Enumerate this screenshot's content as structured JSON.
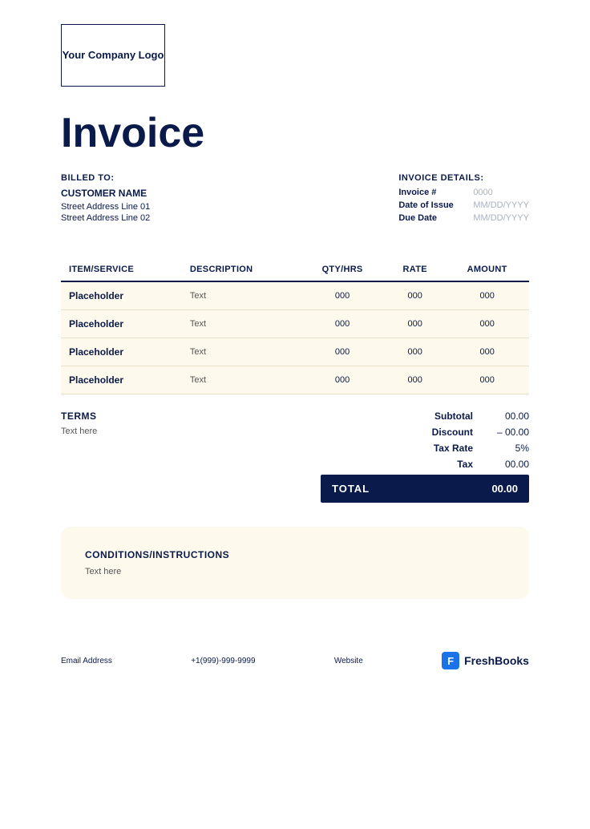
{
  "logo": {
    "text": "Your Company Logo"
  },
  "invoice": {
    "title": "Invoice",
    "billed_to_label": "BILLED TO:",
    "customer_name": "CUSTOMER NAME",
    "address_line1": "Street Address Line 01",
    "address_line2": "Street Address Line 02",
    "details_label": "INVOICE DETAILS:",
    "invoice_number_label": "Invoice #",
    "invoice_number_value": "0000",
    "date_of_issue_label": "Date of Issue",
    "date_of_issue_value": "MM/DD/YYYY",
    "due_date_label": "Due Date",
    "due_date_value": "MM/DD/YYYY"
  },
  "table": {
    "headers": [
      "ITEM/SERVICE",
      "DESCRIPTION",
      "QTY/HRS",
      "RATE",
      "AMOUNT"
    ],
    "rows": [
      {
        "item": "Placeholder",
        "description": "Text",
        "qty": "000",
        "rate": "000",
        "amount": "000"
      },
      {
        "item": "Placeholder",
        "description": "Text",
        "qty": "000",
        "rate": "000",
        "amount": "000"
      },
      {
        "item": "Placeholder",
        "description": "Text",
        "qty": "000",
        "rate": "000",
        "amount": "000"
      },
      {
        "item": "Placeholder",
        "description": "Text",
        "qty": "000",
        "rate": "000",
        "amount": "000"
      }
    ]
  },
  "terms": {
    "label": "TERMS",
    "text": "Text here"
  },
  "totals": {
    "subtotal_label": "Subtotal",
    "subtotal_value": "00.00",
    "discount_label": "Discount",
    "discount_value": "– 00.00",
    "tax_rate_label": "Tax Rate",
    "tax_rate_value": "5%",
    "tax_label": "Tax",
    "tax_value": "00.00",
    "total_label": "TOTAL",
    "total_value": "00.00"
  },
  "conditions": {
    "label": "CONDITIONS/INSTRUCTIONS",
    "text": "Text here"
  },
  "footer": {
    "email": "Email Address",
    "phone": "+1(999)-999-9999",
    "website": "Website",
    "brand": "FreshBooks",
    "brand_icon": "F"
  }
}
